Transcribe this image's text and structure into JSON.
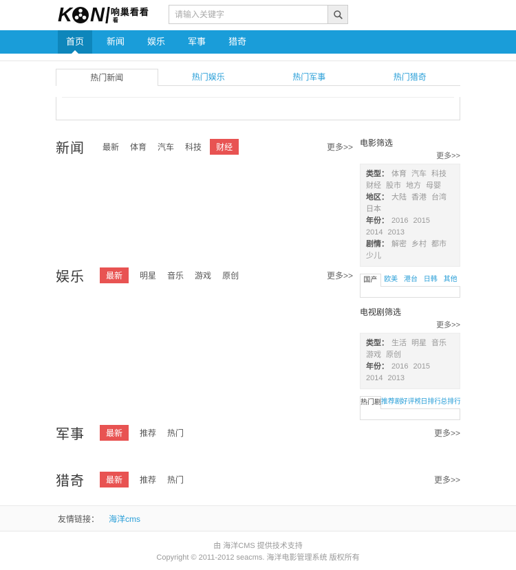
{
  "colors": {
    "nav_blue": "#1a9dd9",
    "nav_active": "#0e86bb",
    "link_blue": "#2a9fd8",
    "accent_red": "#e85352"
  },
  "header": {
    "logo": {
      "k": "K",
      "n": "N",
      "cn": "响巢看看",
      "sub": "看"
    },
    "search": {
      "placeholder": "请输入关键字"
    }
  },
  "nav": {
    "items": [
      {
        "label": "首页",
        "active": true
      },
      {
        "label": "新闻"
      },
      {
        "label": "娱乐"
      },
      {
        "label": "军事"
      },
      {
        "label": "猎奇"
      }
    ]
  },
  "hot_tabs": {
    "tabs": [
      {
        "label": "热门新闻",
        "active": true
      },
      {
        "label": "热门娱乐"
      },
      {
        "label": "热门军事"
      },
      {
        "label": "热门猎奇"
      }
    ]
  },
  "sections": {
    "news": {
      "title": "新闻",
      "more": "更多>>",
      "filters": [
        {
          "label": "最新"
        },
        {
          "label": "体育"
        },
        {
          "label": "汽车"
        },
        {
          "label": "科技"
        },
        {
          "label": "财经",
          "active": true
        }
      ]
    },
    "ent": {
      "title": "娱乐",
      "more": "更多>>",
      "filters": [
        {
          "label": "最新",
          "active": true
        },
        {
          "label": "明星"
        },
        {
          "label": "音乐"
        },
        {
          "label": "游戏"
        },
        {
          "label": "原创"
        }
      ]
    },
    "military": {
      "title": "军事",
      "more": "更多>>",
      "filters": [
        {
          "label": "最新",
          "active": true
        },
        {
          "label": "推荐"
        },
        {
          "label": "热门"
        }
      ]
    },
    "oddity": {
      "title": "猎奇",
      "more": "更多>>",
      "filters": [
        {
          "label": "最新",
          "active": true
        },
        {
          "label": "推荐"
        },
        {
          "label": "热门"
        }
      ]
    }
  },
  "sidebar": {
    "movie": {
      "title": "电影筛选",
      "more": "更多>>",
      "rows": [
        {
          "label": "类型：",
          "values": [
            "体育",
            "汽车",
            "科技",
            "财经",
            "股市",
            "地方",
            "母婴"
          ]
        },
        {
          "label": "地区：",
          "values": [
            "大陆",
            "香港",
            "台湾",
            "日本"
          ]
        },
        {
          "label": "年份：",
          "values": [
            "2016",
            "2015",
            "2014",
            "2013"
          ]
        },
        {
          "label": "剧情：",
          "values": [
            "解密",
            "乡村",
            "都市",
            "少儿"
          ]
        }
      ],
      "tabs": [
        {
          "label": "国产",
          "active": true
        },
        {
          "label": "欧美"
        },
        {
          "label": "港台"
        },
        {
          "label": "日韩"
        },
        {
          "label": "其他"
        }
      ]
    },
    "tv": {
      "title": "电视剧筛选",
      "more": "更多>>",
      "rows": [
        {
          "label": "类型：",
          "values": [
            "生活",
            "明星",
            "音乐",
            "游戏",
            "原创"
          ]
        },
        {
          "label": "年份：",
          "values": [
            "2016",
            "2015",
            "2014",
            "2013"
          ]
        }
      ],
      "tabs": [
        {
          "label": "热门剧",
          "active": true
        },
        {
          "label": "推荐剧"
        },
        {
          "label": "好评榜"
        },
        {
          "label": "日排行"
        },
        {
          "label": "总排行"
        }
      ]
    }
  },
  "friend_links": {
    "label": "友情链接：",
    "links": [
      "海洋cms"
    ]
  },
  "footer": {
    "line1": "由 海洋CMS 提供技术支持",
    "line2": "Copyright © 2011-2012 seacms. 海洋电影管理系统 版权所有"
  }
}
